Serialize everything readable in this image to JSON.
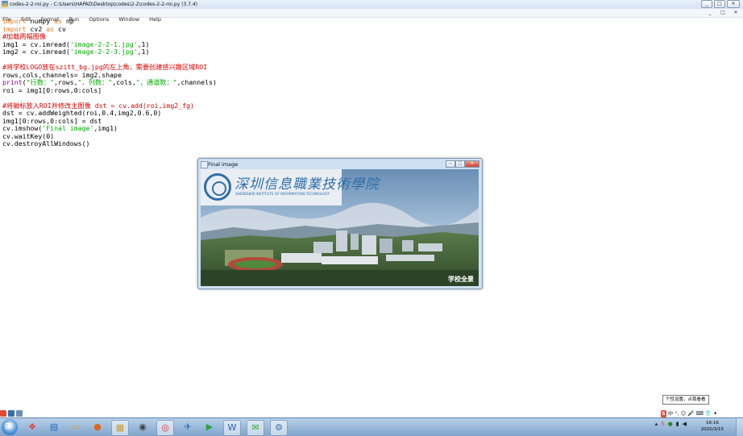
{
  "window": {
    "title": "codes-2-2-roi.py - C:\\Users\\HAPAD\\Desktop\\codes\\2-2\\codes-2-2-roi.py (3.7.4)",
    "controls": [
      "_",
      "□",
      "✕"
    ]
  },
  "menu": [
    "File",
    "Edit",
    "Format",
    "Run",
    "Options",
    "Window",
    "Help"
  ],
  "menu_controls": [
    "_",
    "□",
    "✕"
  ],
  "code": {
    "l1a": "import",
    "l1b": " numpy ",
    "l1c": "as",
    "l1d": " np",
    "l2a": "import",
    "l2b": " cv2 ",
    "l2c": "as",
    "l2d": " cv",
    "l3": "#加载两幅图像",
    "l4a": "img1 = cv.imread(",
    "l4b": "'image-2-2-1.jpg'",
    "l4c": ",1)",
    "l5a": "img2 = cv.imread(",
    "l5b": "'image-2-2-3.jpg'",
    "l5c": ",1)",
    "l7": "#将学校LOGO放在szitt_bg.jpg的左上角，需要创建感兴趣区域ROI",
    "l8": "rows,cols,channels= img2.shape",
    "l9a": "print",
    "l9b": "(",
    "l9c": "\"行数：\"",
    "l9d": ",rows,",
    "l9e": "\"，列数：\"",
    "l9f": ",cols,",
    "l9g": "\"，通道数：\"",
    "l9h": ",channels)",
    "l10": "roi = img1[0:rows,0:cols]",
    "l12": "#将徽标放入ROI并修改主图像 dst = cv.add(roi,img2_fg)",
    "l13": "dst = cv.addWeighted(roi,0.4,img2,0.6,0)",
    "l14": "img1[0:rows,0:cols] = dst",
    "l15a": "cv.imshow(",
    "l15b": "'Final image'",
    "l15c": ",img1)",
    "l16": "cv.waitKey(0)",
    "l17": "cv.destroyAllWindows()"
  },
  "popup": {
    "title": "Final image",
    "controls": [
      "—",
      "□",
      "✕"
    ],
    "logo_cn": "深圳信息職業技術學院",
    "logo_en": "SHENZHEN INSTITUTE OF INFORMATION TECHNOLOGY",
    "caption": "学校全景"
  },
  "tooltip": "个性设置，点我看看",
  "taskbar": {
    "apps": [
      "file-manager-icon",
      "media-player-icon",
      "firefox-icon",
      "folder-icon",
      "video-player-icon",
      "chrome-icon",
      "feather-icon",
      "play-icon",
      "wps-icon",
      "wechat-icon",
      "python-idle-icon"
    ],
    "time": "16:16",
    "date": "2020/3/15"
  },
  "ime": [
    "S",
    "中",
    "°,",
    "☺",
    "🎤",
    "⌨",
    "👕",
    "✦"
  ]
}
